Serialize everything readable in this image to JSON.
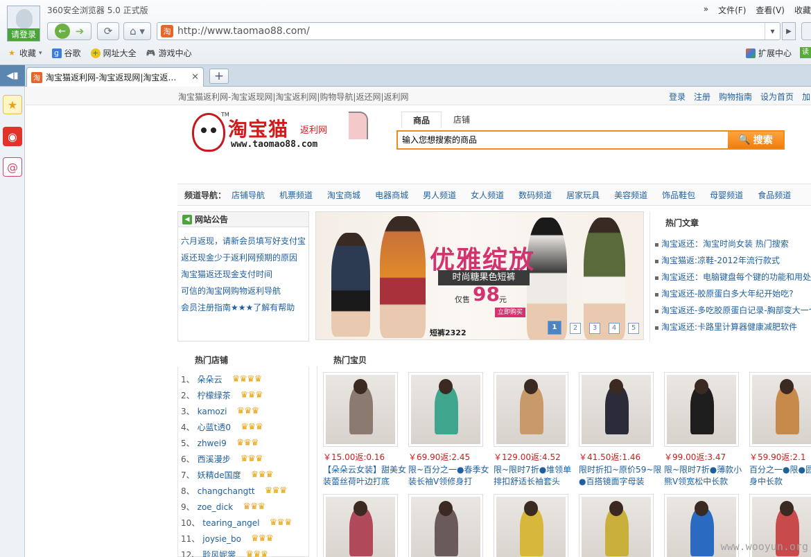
{
  "browser": {
    "app_title": "360安全浏览器 5.0 正式版",
    "login_label": "请登录",
    "menu": [
      "文件(F)",
      "查看(V)",
      "收藏"
    ],
    "url": "http://www.taomao88.com/",
    "bookmarks": [
      {
        "label": "收藏",
        "icon": "star-icon"
      },
      {
        "label": "谷歌",
        "icon": "google-icon"
      },
      {
        "label": "网址大全",
        "icon": "globe-icon"
      },
      {
        "label": "游戏中心",
        "icon": "gamepad-icon"
      }
    ],
    "extension_center": "扩展中心",
    "tab_title": "淘宝猫返利网-淘宝返现网|淘宝返…",
    "favicon_char": "淘"
  },
  "site": {
    "topbar_left": "淘宝猫返利网-淘宝返现网|淘宝返利网|购物导航|返还网|返利网",
    "topbar_links": [
      "登录",
      "注册",
      "购物指南",
      "设为首页",
      "加"
    ],
    "logo": {
      "name": "淘宝猫",
      "sub": "返利网",
      "url": "www.taomao88.com",
      "tm": "TM"
    },
    "search": {
      "tabs": [
        "商品",
        "店铺"
      ],
      "value": "输入您想搜索的商品",
      "button": "搜索"
    },
    "channel": {
      "label": "频道导航：",
      "links": [
        "店铺导航",
        "机票频道",
        "淘宝商城",
        "电器商城",
        "男人频道",
        "女人频道",
        "数码频道",
        "居家玩具",
        "美容频道",
        "饰品鞋包",
        "母婴频道",
        "食品频道"
      ]
    },
    "notice": {
      "title": "网站公告",
      "items": [
        "六月返现，请新会员填写好支付宝",
        "返还现金少于返利网预期的原因",
        "淘宝猫返还现金支付时间",
        "可信的淘宝网购物返利导航",
        "会员注册指南★★★了解有帮助"
      ]
    },
    "banner": {
      "title": "优雅绽放",
      "subtitle": "时尚糖果色短裤",
      "price_label": "仅售",
      "price": "98",
      "unit": "元",
      "buy": "立即购买",
      "code": "短裤2322",
      "pages": [
        "1",
        "2",
        "3",
        "4",
        "5"
      ],
      "active_page": 1
    },
    "articles": {
      "title": "热门文章",
      "items": [
        "淘宝返还：淘宝时尚女装 热门搜索",
        "淘宝猫返:凉鞋-2012年流行款式",
        "淘宝返还：电脑键盘每个键的功能和用处",
        "淘宝返还-胶原蛋白多大年纪开始吃?",
        "淘宝返还-多吃胶原蛋白记录-胸部变大一个",
        "淘宝返还:卡路里计算器健康减肥软件"
      ]
    },
    "shops": {
      "title": "热门店铺",
      "items": [
        {
          "rank": "1、",
          "name": "朵朵云",
          "crowns": 4
        },
        {
          "rank": "2、",
          "name": "柠檬绿茶",
          "crowns": 3
        },
        {
          "rank": "3、",
          "name": "kamozi",
          "crowns": 3
        },
        {
          "rank": "4、",
          "name": "心蓝t透0",
          "crowns": 3
        },
        {
          "rank": "5、",
          "name": "zhwei9",
          "crowns": 3
        },
        {
          "rank": "6、",
          "name": "西溪漫步",
          "crowns": 3
        },
        {
          "rank": "7、",
          "name": "妖精de国度",
          "crowns": 3
        },
        {
          "rank": "8、",
          "name": "changchangtt",
          "crowns": 3
        },
        {
          "rank": "9、",
          "name": "zoe_dick",
          "crowns": 3
        },
        {
          "rank": "10、",
          "name": "tearing_angel",
          "crowns": 3
        },
        {
          "rank": "11、",
          "name": "joysie_bo",
          "crowns": 3
        },
        {
          "rank": "12、",
          "name": "聆风妮裳",
          "crowns": 3
        }
      ]
    },
    "products": {
      "title": "热门宝贝",
      "items": [
        {
          "price": "￥15.00返:0.16",
          "title": "【朵朵云女装】甜美女装蕾丝荷叶边打底",
          "color": "#8a7a70"
        },
        {
          "price": "￥69.90返:2.45",
          "title": "限~百分之一●春季女装长袖V领修身打",
          "color": "#3fa58c"
        },
        {
          "price": "￥129.00返:4.52",
          "title": "限~限时7折●堆领单排扣舒适长袖套头",
          "color": "#c89a6a"
        },
        {
          "price": "￥41.50返:1.46",
          "title": "限时折扣~原价59~限●百搭镜面字母装",
          "color": "#2b2b3a"
        },
        {
          "price": "￥99.00返:3.47",
          "title": "限~限时7折●薄款小熊V领宽松中长款",
          "color": "#1e1e1e"
        },
        {
          "price": "￥59.90返:2.1",
          "title": "百分之一●限●圆领修身中长款",
          "color": "#c88a4a"
        }
      ],
      "row2_colors": [
        "#b04a5a",
        "#6a5a5a",
        "#d8b83a",
        "#c8b03a",
        "#2a6ac0",
        "#c84a4a"
      ]
    },
    "watermark": "www.wooyun.org"
  }
}
